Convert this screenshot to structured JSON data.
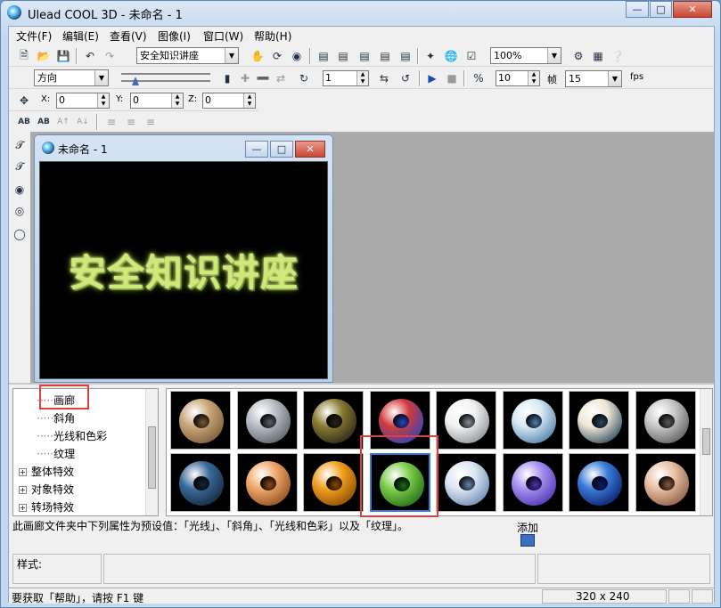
{
  "app": {
    "title": "Ulead COOL 3D - 未命名 - 1"
  },
  "menu": [
    "文件(F)",
    "编辑(E)",
    "查看(V)",
    "图像(I)",
    "窗口(W)",
    "帮助(H)"
  ],
  "toolbar1": {
    "text_combo": "安全知识讲座",
    "zoom": "100%"
  },
  "toolbar2": {
    "direction": "方向",
    "frame_value": "1",
    "frame_count": "10",
    "frame_label": "帧",
    "fps_value": "15",
    "fps_label": "fps"
  },
  "toolbar3": {
    "x_label": "X:",
    "x_value": "0",
    "y_label": "Y:",
    "y_value": "0",
    "z_label": "Z:",
    "z_value": "0"
  },
  "toolbar4": {
    "items": [
      "AB",
      "AB",
      "A↑",
      "A↓"
    ]
  },
  "document": {
    "title": "未命名 - 1",
    "canvas_text": "安全知识讲座"
  },
  "tree": {
    "items": [
      {
        "label": "画廊",
        "level": 2,
        "selected": true
      },
      {
        "label": "斜角",
        "level": 2
      },
      {
        "label": "光线和色彩",
        "level": 2
      },
      {
        "label": "纹理",
        "level": 2
      },
      {
        "label": "整体特效",
        "level": 1
      },
      {
        "label": "对象特效",
        "level": 1
      },
      {
        "label": "转场特效",
        "level": 1
      }
    ]
  },
  "gallery": {
    "selected_index": 11,
    "thumbs": [
      {
        "ring": "#c9a77a",
        "ring2": "#7a5a38"
      },
      {
        "ring": "#b8bcc4",
        "ring2": "#5a5e68"
      },
      {
        "ring": "#8a7a30",
        "ring2": "#2a2418"
      },
      {
        "ring": "#d23a3a",
        "ring2": "#2a46c0"
      },
      {
        "ring": "#f2f2f2",
        "ring2": "#8a8f96"
      },
      {
        "ring": "#d8e8f4",
        "ring2": "#4d7ea8"
      },
      {
        "ring": "#efe6d6",
        "ring2": "#2c4a5e"
      },
      {
        "ring": "#c8c8c8",
        "ring2": "#5a5a5a"
      },
      {
        "ring": "#3a6a9a",
        "ring2": "#12263a"
      },
      {
        "ring": "#f0a86a",
        "ring2": "#8a4a1a"
      },
      {
        "ring": "#f0a020",
        "ring2": "#8a4a00"
      },
      {
        "ring": "#7ccc4a",
        "ring2": "#1e6a14"
      },
      {
        "ring": "#dce6f4",
        "ring2": "#6a86b0"
      },
      {
        "ring": "#a890f0",
        "ring2": "#4a34b0"
      },
      {
        "ring": "#3a7ad8",
        "ring2": "#0a1e6a"
      },
      {
        "ring": "#e8c0a4",
        "ring2": "#8a5a44"
      }
    ]
  },
  "description": "此画廊文件夹中下列属性为预设值：「光线」、「斜角」、「光线和色彩」以及「纹理」。",
  "add_label": "添加",
  "style_label": "样式:",
  "status": {
    "help": "要获取「帮助」，请按 F1 键",
    "size": "320 x 240"
  },
  "colors": {
    "highlight": "#e0403a",
    "canvas_text": "#cfe87a"
  }
}
